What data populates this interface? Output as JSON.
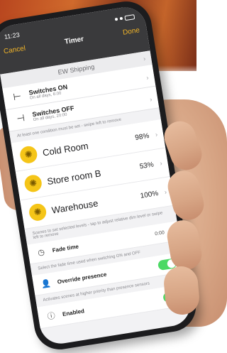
{
  "status_bar": {
    "time": "11:23"
  },
  "nav": {
    "cancel": "Cancel",
    "title": "Timer",
    "done": "Done"
  },
  "group_name": "EW Shipping",
  "switches": {
    "on_title": "Switches ON",
    "on_sub": "On all days, 6:00",
    "off_title": "Switches OFF",
    "off_sub": "On all days, 20:00",
    "hint": "At least one condition must be set - swipe left to remove"
  },
  "rooms": [
    {
      "name": "Cold Room",
      "value": "98%"
    },
    {
      "name": "Store room B",
      "value": "53%"
    },
    {
      "name": "Warehouse",
      "value": "100%"
    }
  ],
  "scene_hint": "Scenes to set selected levels - tap to adjust relative dim level or swipe left to remove",
  "fade": {
    "label": "Fade time",
    "value": "0:00",
    "hint": "Select the fade time used when switching ON and OFF"
  },
  "presence": {
    "label": "Override presence",
    "hint": "Activates scenes at higher priority than presence sensors"
  },
  "enabled": {
    "label": "Enabled"
  },
  "colors": {
    "accent": "#f0b429",
    "toggle": "#4cd964",
    "bulb": "#f5c518",
    "topbar": "#3a3a3c"
  },
  "icons": {
    "switch_on": "switch-on-icon",
    "switch_off": "switch-off-icon",
    "bulb": "bulb-icon",
    "clock": "clock-icon",
    "person": "person-icon",
    "info": "info-icon"
  }
}
